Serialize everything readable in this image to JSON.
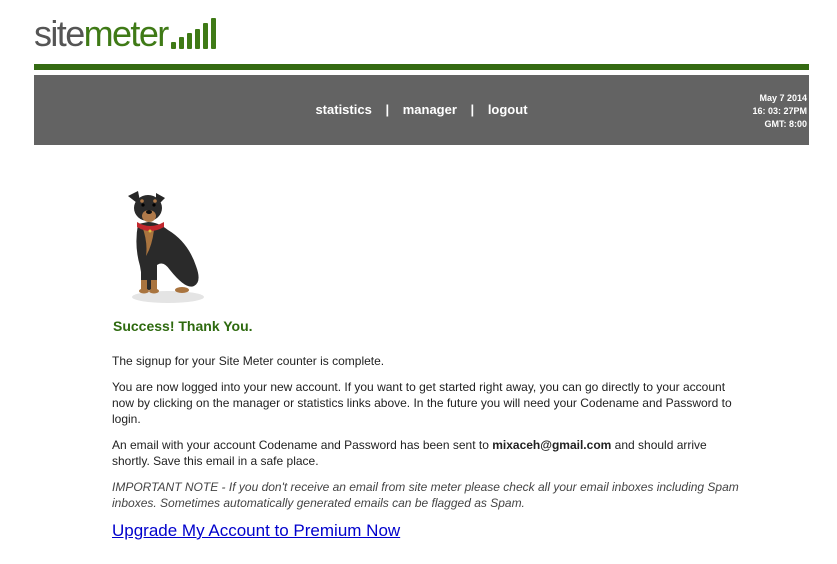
{
  "logo": {
    "part1": "site",
    "part2": "meter",
    "bar_count": 6
  },
  "colors": {
    "brand_green": "#3f7a16",
    "nav_bg": "#636363",
    "title_green": "#2e6a0f",
    "link_blue": "#0000cc"
  },
  "nav": {
    "statistics": "statistics",
    "separator": "|",
    "manager": "manager",
    "logout": "logout"
  },
  "datetime": {
    "date": "May 7 2014",
    "time": "16: 03: 27PM",
    "tz": "GMT: 8:00"
  },
  "image": {
    "name": "dog-photo"
  },
  "content": {
    "title": "Success! Thank You.",
    "p1": "The signup for your Site Meter counter is complete.",
    "p2": "You are now logged into your new account. If you want to get started right away, you can go directly to your account now by clicking on the manager or statistics links above. In the future you will need your Codename and Password to login.",
    "p3_pre": "An email with your account Codename and Password has been sent to ",
    "email": "mixaceh@gmail.com",
    "p3_post": " and should arrive shortly. Save this email in a safe place.",
    "note": "IMPORTANT NOTE - If you don't receive an email from site meter please check all your email inboxes including Spam inboxes. Sometimes automatically generated emails can be flagged as Spam.",
    "upgrade_link": "Upgrade My Account to Premium Now"
  }
}
